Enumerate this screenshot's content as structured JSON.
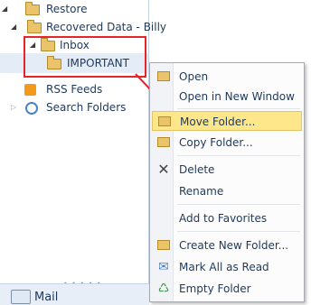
{
  "tree": {
    "items": [
      {
        "label": "Restore"
      },
      {
        "label": "Recovered Data - Billy"
      },
      {
        "label": "Inbox"
      },
      {
        "label": "IMPORTANT"
      },
      {
        "label": "RSS Feeds"
      },
      {
        "label": "Search Folders"
      }
    ]
  },
  "nav": {
    "mail_label": "Mail",
    "dots": "• • • • •"
  },
  "menu": {
    "items": [
      {
        "label": "Open",
        "icon": "open-folder-icon"
      },
      {
        "label": "Open in New Window"
      },
      {
        "label": "Move Folder...",
        "icon": "move-folder-icon"
      },
      {
        "label": "Copy Folder...",
        "icon": "copy-folder-icon"
      },
      {
        "label": "Delete",
        "icon": "delete-x-icon"
      },
      {
        "label": "Rename"
      },
      {
        "label": "Add to Favorites"
      },
      {
        "label": "Create New Folder...",
        "icon": "new-folder-icon"
      },
      {
        "label": "Mark All as Read",
        "icon": "mark-read-icon"
      },
      {
        "label": "Empty Folder",
        "icon": "empty-folder-icon"
      }
    ]
  },
  "colors": {
    "highlight": "#fde78a",
    "annotation_red": "#e8242b",
    "text": "#1e395b"
  }
}
